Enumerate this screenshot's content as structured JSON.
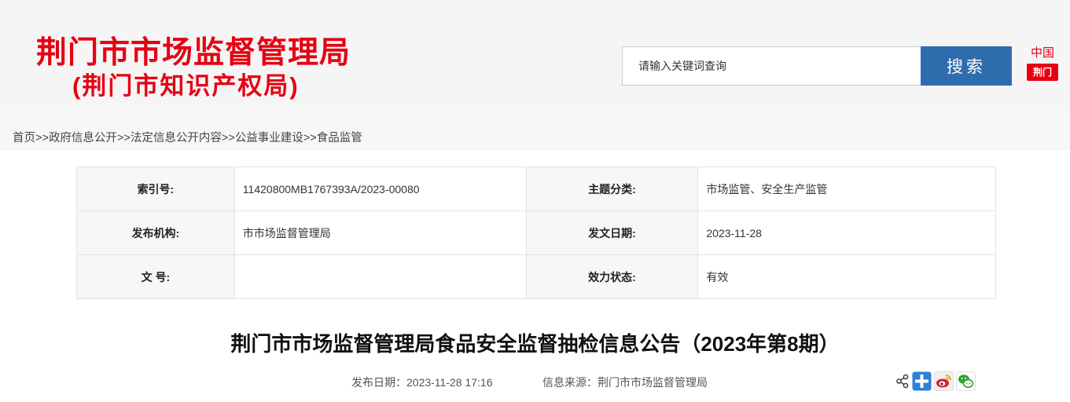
{
  "header": {
    "title_line1": "荆门市市场监督管理局",
    "title_line2": "(荆门市知识产权局)",
    "search": {
      "placeholder": "请输入关键词查询",
      "button_label": "搜索"
    },
    "china_logo": {
      "top_text": "中国",
      "bottom_text": "荆门"
    }
  },
  "breadcrumb": {
    "items": [
      "首页",
      "政府信息公开",
      "法定信息公开内容",
      "公益事业建设",
      "食品监管"
    ],
    "separator": ">>"
  },
  "meta": {
    "rows": [
      [
        {
          "label": "索引号:",
          "value": "11420800MB1767393A/2023-00080"
        },
        {
          "label": "主题分类:",
          "value": "市场监管、安全生产监管"
        }
      ],
      [
        {
          "label": "发布机构:",
          "value": "市市场监督管理局"
        },
        {
          "label": "发文日期:",
          "value": "2023-11-28"
        }
      ],
      [
        {
          "label": "文 号:",
          "value": ""
        },
        {
          "label": "效力状态:",
          "value": "有效"
        }
      ]
    ]
  },
  "article": {
    "title": "荆门市市场监督管理局食品安全监督抽检信息公告（2023年第8期）",
    "publish_date_label": "发布日期：",
    "publish_date": "2023-11-28 17:16",
    "source_label": "信息来源：",
    "source": "荆门市市场监督管理局"
  },
  "share": {
    "icons": [
      "share-icon",
      "plus-share-icon",
      "weibo-icon",
      "wechat-icon"
    ]
  },
  "colors": {
    "brand_red": "#e60012",
    "search_button": "#2e6cae",
    "header_bg": "#f5f5f5"
  }
}
